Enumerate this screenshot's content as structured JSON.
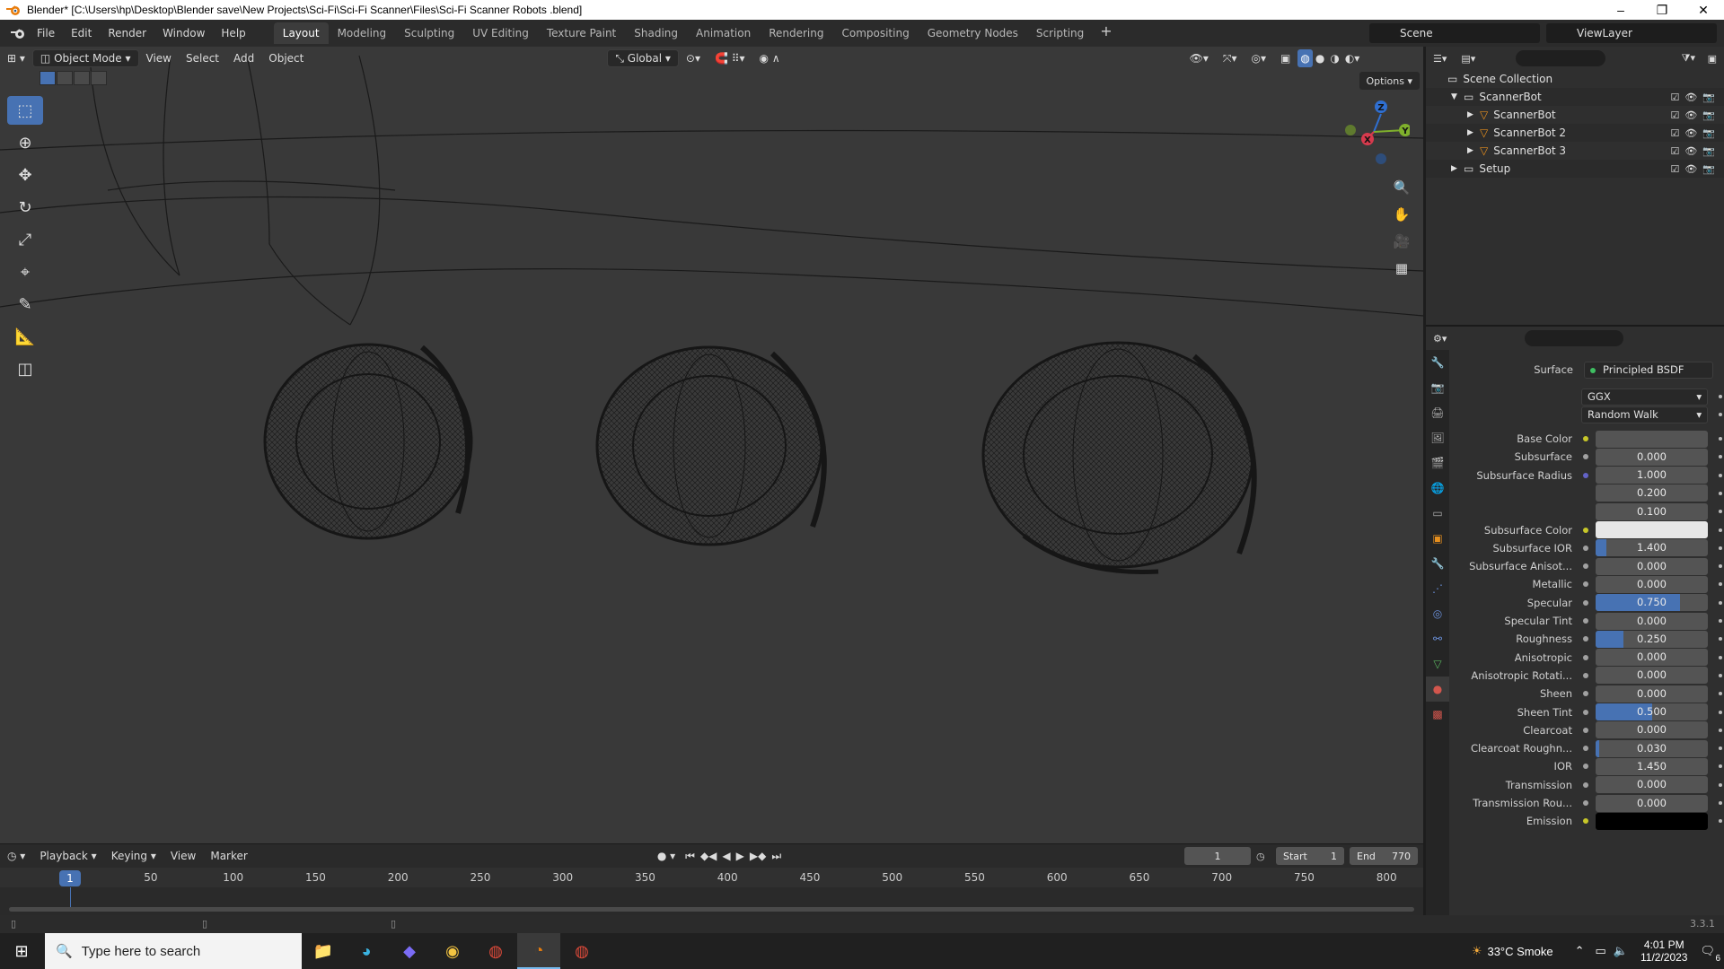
{
  "window": {
    "title": "Blender* [C:\\Users\\hp\\Desktop\\Blender save\\New Projects\\Sci-Fi\\Sci-Fi Scanner\\Files\\Sci-Fi Scanner Robots .blend]",
    "minimize": "–",
    "maximize": "❐",
    "close": "✕"
  },
  "menu": [
    "File",
    "Edit",
    "Render",
    "Window",
    "Help"
  ],
  "workspaces": [
    "Layout",
    "Modeling",
    "Sculpting",
    "UV Editing",
    "Texture Paint",
    "Shading",
    "Animation",
    "Rendering",
    "Compositing",
    "Geometry Nodes",
    "Scripting"
  ],
  "active_workspace": "Layout",
  "add_workspace": "+",
  "scene": "Scene",
  "view_layer": "ViewLayer",
  "viewport": {
    "mode": "Object Mode",
    "menus": [
      "View",
      "Select",
      "Add",
      "Object"
    ],
    "transform_orientation": "Global",
    "options_label": "Options"
  },
  "gizmo": {
    "x": "X",
    "y": "Y",
    "z": "Z"
  },
  "timeline": {
    "menus": [
      "Playback",
      "Keying",
      "View",
      "Marker"
    ],
    "current_frame": "1",
    "start_label": "Start",
    "start": "1",
    "end_label": "End",
    "end": "770",
    "ticks": [
      "50",
      "100",
      "150",
      "200",
      "250",
      "300",
      "350",
      "400",
      "450",
      "500",
      "550",
      "600",
      "650",
      "700",
      "750",
      "800"
    ],
    "cursor_frame": "1"
  },
  "statusbar": {
    "version": "3.3.1"
  },
  "outliner": {
    "rows": [
      {
        "name": "Scene Collection",
        "indent": 0,
        "icon": "collection-icon"
      },
      {
        "name": "ScannerBot",
        "indent": 1,
        "icon": "collection-icon"
      },
      {
        "name": "ScannerBot",
        "indent": 2,
        "icon": "object-icon"
      },
      {
        "name": "ScannerBot 2",
        "indent": 2,
        "icon": "object-icon"
      },
      {
        "name": "ScannerBot 3",
        "indent": 2,
        "icon": "object-icon"
      },
      {
        "name": "Setup",
        "indent": 1,
        "icon": "collection-icon"
      }
    ]
  },
  "properties": {
    "surface_label": "Surface",
    "surface_value": "Principled BSDF",
    "distribution": "GGX",
    "subsurface_method": "Random Walk",
    "rows": [
      {
        "label": "Base Color",
        "value": "",
        "socket": "#c7c729",
        "type": "color",
        "color": "#545454"
      },
      {
        "label": "Subsurface",
        "value": "0.000",
        "socket": "#a1a1a1",
        "fill": 0
      },
      {
        "label": "Subsurface Radius",
        "value": "1.000",
        "socket": "#6363c7",
        "fill": 0
      },
      {
        "label": "",
        "value": "0.200",
        "socket": "",
        "fill": 0
      },
      {
        "label": "",
        "value": "0.100",
        "socket": "",
        "fill": 0
      },
      {
        "label": "Subsurface Color",
        "value": "",
        "socket": "#c7c729",
        "type": "color",
        "color": "#e6e6e6"
      },
      {
        "label": "Subsurface IOR",
        "value": "1.400",
        "socket": "#a1a1a1",
        "fill": 0.1
      },
      {
        "label": "Subsurface Anisot...",
        "value": "0.000",
        "socket": "#a1a1a1",
        "fill": 0
      },
      {
        "label": "Metallic",
        "value": "0.000",
        "socket": "#a1a1a1",
        "fill": 0
      },
      {
        "label": "Specular",
        "value": "0.750",
        "socket": "#a1a1a1",
        "fill": 0.75
      },
      {
        "label": "Specular Tint",
        "value": "0.000",
        "socket": "#a1a1a1",
        "fill": 0
      },
      {
        "label": "Roughness",
        "value": "0.250",
        "socket": "#a1a1a1",
        "fill": 0.25
      },
      {
        "label": "Anisotropic",
        "value": "0.000",
        "socket": "#a1a1a1",
        "fill": 0
      },
      {
        "label": "Anisotropic Rotati...",
        "value": "0.000",
        "socket": "#a1a1a1",
        "fill": 0
      },
      {
        "label": "Sheen",
        "value": "0.000",
        "socket": "#a1a1a1",
        "fill": 0
      },
      {
        "label": "Sheen Tint",
        "value": "0.500",
        "socket": "#a1a1a1",
        "fill": 0.5
      },
      {
        "label": "Clearcoat",
        "value": "0.000",
        "socket": "#a1a1a1",
        "fill": 0
      },
      {
        "label": "Clearcoat Roughn...",
        "value": "0.030",
        "socket": "#a1a1a1",
        "fill": 0.03
      },
      {
        "label": "IOR",
        "value": "1.450",
        "socket": "#a1a1a1",
        "fill": 0
      },
      {
        "label": "Transmission",
        "value": "0.000",
        "socket": "#a1a1a1",
        "fill": 0
      },
      {
        "label": "Transmission Rou...",
        "value": "0.000",
        "socket": "#a1a1a1",
        "fill": 0
      },
      {
        "label": "Emission",
        "value": "",
        "socket": "#c7c729",
        "type": "color",
        "color": "#000000"
      }
    ]
  },
  "taskbar": {
    "search_placeholder": "Type here to search",
    "weather": "33°C  Smoke",
    "time": "4:01 PM",
    "date": "11/2/2023",
    "notifications": "6"
  },
  "colors": {
    "accent": "#4772b3",
    "viewport_bg": "#393939",
    "panel_bg": "#2f2f2f"
  }
}
